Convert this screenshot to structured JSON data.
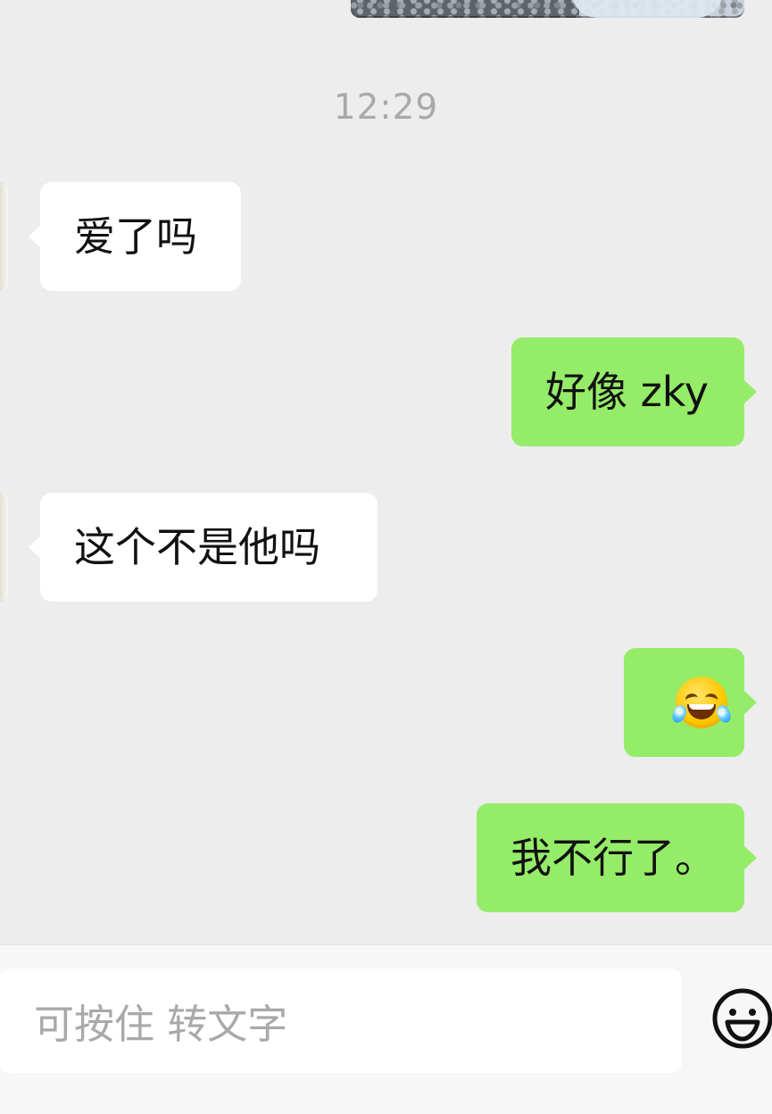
{
  "timestamp": "12:29",
  "messages": [
    {
      "side": "left",
      "text": "爱了吗"
    },
    {
      "side": "right",
      "text": "好像 zky"
    },
    {
      "side": "left",
      "text": "这个不是他吗"
    },
    {
      "side": "right",
      "emoji": "tears-of-joy-emoji"
    },
    {
      "side": "right",
      "text": "我不行了。"
    }
  ],
  "input": {
    "placeholder": "可按住 转文字"
  },
  "toolbar": {
    "emoji_button_icon": "smile-emoji-icon"
  },
  "colors": {
    "chat_background": "#ededed",
    "incoming_bubble": "#ffffff",
    "outgoing_bubble": "#95ec69",
    "timestamp_text": "#a9a9a9",
    "input_background": "#ffffff",
    "bottom_bar": "#f7f7f7"
  },
  "watermark": ""
}
